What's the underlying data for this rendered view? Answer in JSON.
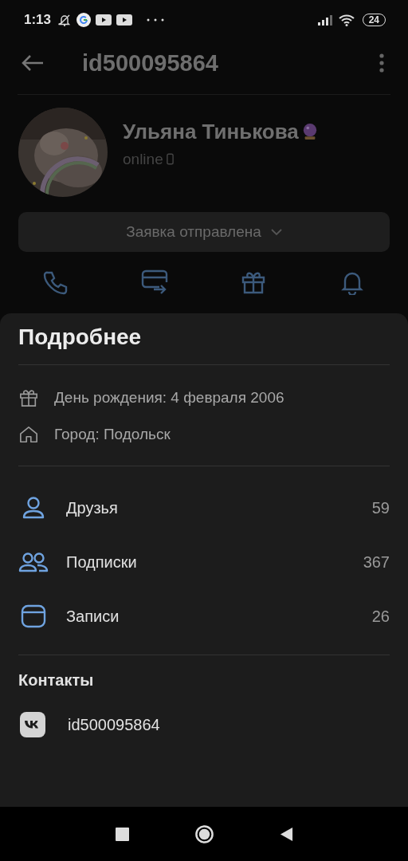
{
  "status_bar": {
    "time": "1:13",
    "battery": "24"
  },
  "header": {
    "title": "id500095864"
  },
  "profile": {
    "name": "Ульяна Тинькова",
    "status": "online"
  },
  "request_button": {
    "label": "Заявка отправлена"
  },
  "actions": [
    {
      "kind": "call"
    },
    {
      "kind": "money"
    },
    {
      "kind": "gift"
    },
    {
      "kind": "notifications"
    }
  ],
  "sheet": {
    "title": "Подробнее",
    "info": [
      {
        "kind": "birthday",
        "text": "День рождения: 4 февраля 2006"
      },
      {
        "kind": "city",
        "text": "Город: Подольск"
      }
    ],
    "counters": [
      {
        "kind": "friends",
        "label": "Друзья",
        "count": "59"
      },
      {
        "kind": "subscriptions",
        "label": "Подписки",
        "count": "367"
      },
      {
        "kind": "posts",
        "label": "Записи",
        "count": "26"
      }
    ],
    "contacts_title": "Контакты",
    "contacts": [
      {
        "kind": "vk",
        "text": "id500095864"
      }
    ]
  }
}
